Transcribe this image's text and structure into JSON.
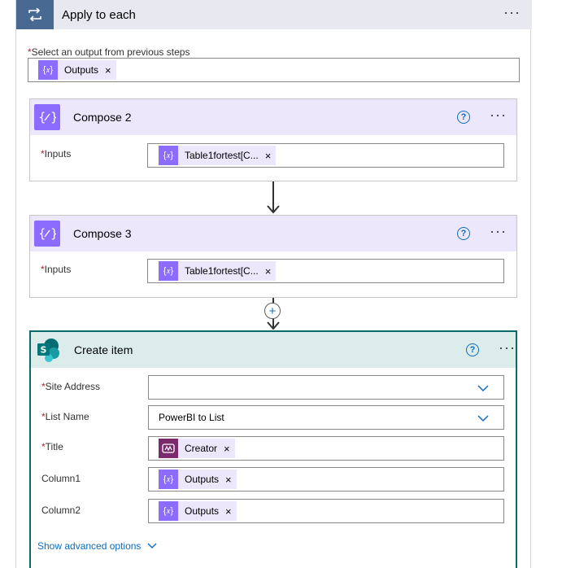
{
  "apply": {
    "title": "Apply to each",
    "icon": "loop-icon",
    "select_label": "Select an output from previous steps",
    "select_token": "Outputs"
  },
  "compose2": {
    "title": "Compose 2",
    "inputs_label": "Inputs",
    "inputs_token": "Table1fortest[C..."
  },
  "compose3": {
    "title": "Compose 3",
    "inputs_label": "Inputs",
    "inputs_token": "Table1fortest[C..."
  },
  "create_item": {
    "title": "Create item",
    "site_address_label": "Site Address",
    "site_address_value": "",
    "list_name_label": "List Name",
    "list_name_value": "PowerBI to List",
    "title_label": "Title",
    "title_token": "Creator",
    "column1_label": "Column1",
    "column1_token": "Outputs",
    "column2_label": "Column2",
    "column2_token": "Outputs",
    "advanced_label": "Show advanced options"
  },
  "common": {
    "required_mark": "*",
    "close_glyph": "×",
    "help_glyph": "?",
    "more_glyph": "···",
    "plus_glyph": "+"
  },
  "colors": {
    "loop_header": "#486991",
    "compose_accent": "#8c6cff",
    "compose_header_bg": "#ece7fb",
    "sharepoint_border": "#0b6a6a",
    "sharepoint_header_bg": "#dbeceb",
    "link_blue": "#0f6cbd",
    "powerbi_token": "#7b2a6e"
  }
}
